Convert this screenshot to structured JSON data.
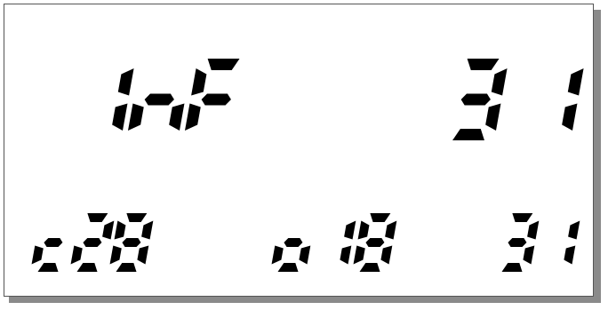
{
  "display": {
    "segment_color": "#000000",
    "background_color": "#ffffff",
    "main_row": {
      "left_text": "1nF",
      "right_text": "31"
    },
    "bottom_row": [
      {
        "text": "c28"
      },
      {
        "text": "o18"
      },
      {
        "text": "31"
      }
    ]
  }
}
